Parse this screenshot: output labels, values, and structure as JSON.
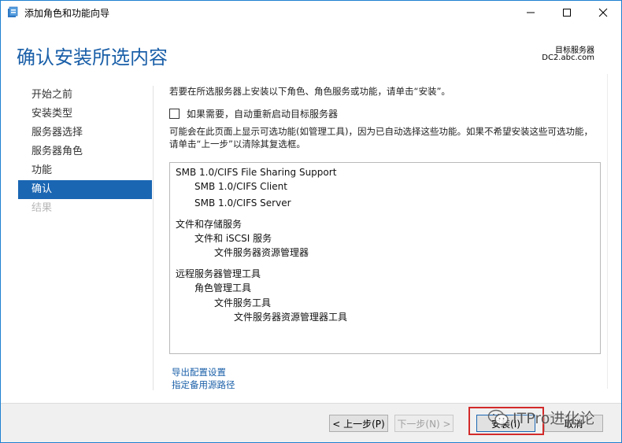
{
  "window": {
    "title": "添加角色和功能向导"
  },
  "header": {
    "page_title": "确认安装所选内容",
    "target_server_label": "目标服务器",
    "target_server_value": "DC2.abc.com"
  },
  "nav": {
    "items": [
      {
        "label": "开始之前",
        "state": "normal"
      },
      {
        "label": "安装类型",
        "state": "normal"
      },
      {
        "label": "服务器选择",
        "state": "normal"
      },
      {
        "label": "服务器角色",
        "state": "normal"
      },
      {
        "label": "功能",
        "state": "normal"
      },
      {
        "label": "确认",
        "state": "active"
      },
      {
        "label": "结果",
        "state": "disabled"
      }
    ]
  },
  "content": {
    "instruction": "若要在所选服务器上安装以下角色、角色服务或功能，请单击“安装”。",
    "restart_checkbox_label": "如果需要，自动重新启动目标服务器",
    "restart_checkbox_checked": false,
    "note": "可能会在此页面上显示可选功能(如管理工具)，因为已自动选择这些功能。如果不希望安装这些可选功能，请单击“上一步”以清除其复选框。",
    "features": [
      {
        "label": "SMB 1.0/CIFS File Sharing Support",
        "level": 0
      },
      {
        "label": "SMB 1.0/CIFS Client",
        "level": 1
      },
      {
        "label": "SMB 1.0/CIFS Server",
        "level": 1
      },
      {
        "label": "文件和存储服务",
        "level": 0
      },
      {
        "label": "文件和 iSCSI 服务",
        "level": 1
      },
      {
        "label": "文件服务器资源管理器",
        "level": 2
      },
      {
        "label": "远程服务器管理工具",
        "level": 0
      },
      {
        "label": "角色管理工具",
        "level": 1
      },
      {
        "label": "文件服务工具",
        "level": 2
      },
      {
        "label": "文件服务器资源管理器工具",
        "level": 3
      }
    ],
    "export_link": "导出配置设置",
    "alt_source_link": "指定备用源路径"
  },
  "footer": {
    "prev_label": "< 上一步(P)",
    "next_label": "下一步(N) >",
    "install_label": "安装(I)",
    "cancel_label": "取消"
  },
  "watermark": {
    "text": "ITPro进化论"
  }
}
